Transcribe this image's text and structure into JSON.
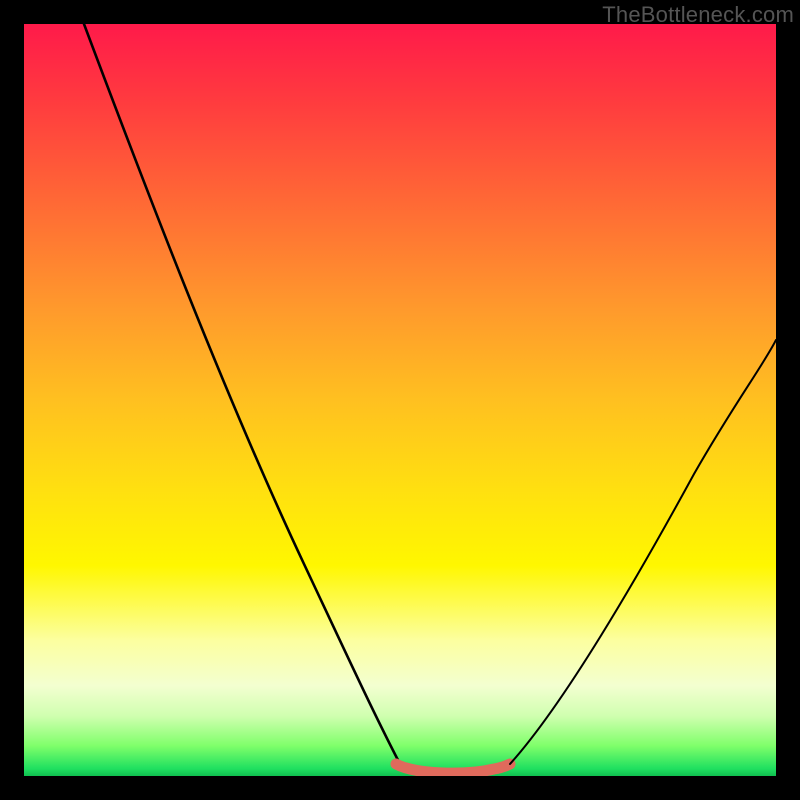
{
  "watermark": "TheBottleneck.com",
  "chart_data": {
    "type": "line",
    "title": "",
    "xlabel": "",
    "ylabel": "",
    "xlim": [
      0,
      100
    ],
    "ylim": [
      0,
      100
    ],
    "background_gradient_stops": [
      {
        "pos": 0,
        "color": "#ff1a4a"
      },
      {
        "pos": 10,
        "color": "#ff3a3f"
      },
      {
        "pos": 24,
        "color": "#ff6a35"
      },
      {
        "pos": 38,
        "color": "#ff9a2c"
      },
      {
        "pos": 50,
        "color": "#ffc020"
      },
      {
        "pos": 62,
        "color": "#ffe010"
      },
      {
        "pos": 72,
        "color": "#fff700"
      },
      {
        "pos": 82,
        "color": "#fcffa0"
      },
      {
        "pos": 88,
        "color": "#f3ffd0"
      },
      {
        "pos": 92,
        "color": "#d0ffb0"
      },
      {
        "pos": 96,
        "color": "#7fff6a"
      },
      {
        "pos": 99,
        "color": "#20e060"
      },
      {
        "pos": 100,
        "color": "#10c050"
      }
    ],
    "series": [
      {
        "name": "left-branch",
        "color": "#000000",
        "x": [
          8,
          12,
          18,
          24,
          30,
          36,
          42,
          47,
          50
        ],
        "y": [
          100,
          90,
          76,
          63,
          48,
          33,
          18,
          6,
          0
        ]
      },
      {
        "name": "flat-min",
        "color": "#e36a5c",
        "x": [
          50,
          53,
          56,
          59,
          62,
          64
        ],
        "y": [
          0.5,
          0.3,
          0.2,
          0.3,
          0.5,
          1
        ]
      },
      {
        "name": "right-branch",
        "color": "#000000",
        "x": [
          64,
          70,
          76,
          82,
          88,
          94,
          100
        ],
        "y": [
          1,
          8,
          18,
          29,
          40,
          50,
          58
        ]
      }
    ],
    "min_highlight": {
      "color": "#e36a5c",
      "x_range": [
        50,
        64
      ]
    }
  }
}
